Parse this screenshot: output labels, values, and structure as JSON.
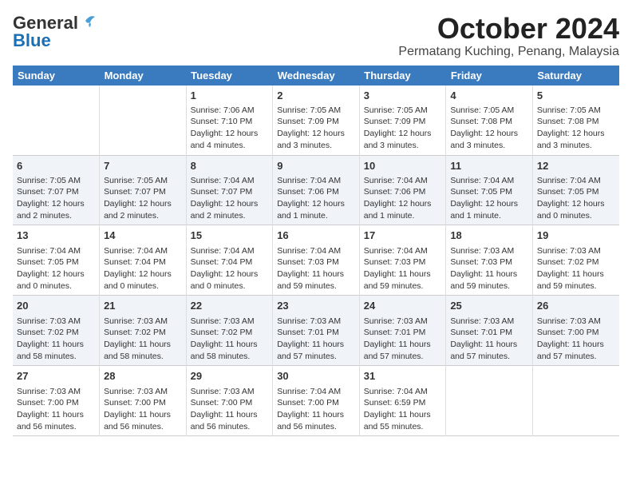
{
  "header": {
    "logo_general": "General",
    "logo_blue": "Blue",
    "month_title": "October 2024",
    "location": "Permatang Kuching, Penang, Malaysia"
  },
  "weekdays": [
    "Sunday",
    "Monday",
    "Tuesday",
    "Wednesday",
    "Thursday",
    "Friday",
    "Saturday"
  ],
  "weeks": [
    [
      {
        "day": "",
        "info": ""
      },
      {
        "day": "",
        "info": ""
      },
      {
        "day": "1",
        "info": "Sunrise: 7:06 AM\nSunset: 7:10 PM\nDaylight: 12 hours and 4 minutes."
      },
      {
        "day": "2",
        "info": "Sunrise: 7:05 AM\nSunset: 7:09 PM\nDaylight: 12 hours and 3 minutes."
      },
      {
        "day": "3",
        "info": "Sunrise: 7:05 AM\nSunset: 7:09 PM\nDaylight: 12 hours and 3 minutes."
      },
      {
        "day": "4",
        "info": "Sunrise: 7:05 AM\nSunset: 7:08 PM\nDaylight: 12 hours and 3 minutes."
      },
      {
        "day": "5",
        "info": "Sunrise: 7:05 AM\nSunset: 7:08 PM\nDaylight: 12 hours and 3 minutes."
      }
    ],
    [
      {
        "day": "6",
        "info": "Sunrise: 7:05 AM\nSunset: 7:07 PM\nDaylight: 12 hours and 2 minutes."
      },
      {
        "day": "7",
        "info": "Sunrise: 7:05 AM\nSunset: 7:07 PM\nDaylight: 12 hours and 2 minutes."
      },
      {
        "day": "8",
        "info": "Sunrise: 7:04 AM\nSunset: 7:07 PM\nDaylight: 12 hours and 2 minutes."
      },
      {
        "day": "9",
        "info": "Sunrise: 7:04 AM\nSunset: 7:06 PM\nDaylight: 12 hours and 1 minute."
      },
      {
        "day": "10",
        "info": "Sunrise: 7:04 AM\nSunset: 7:06 PM\nDaylight: 12 hours and 1 minute."
      },
      {
        "day": "11",
        "info": "Sunrise: 7:04 AM\nSunset: 7:05 PM\nDaylight: 12 hours and 1 minute."
      },
      {
        "day": "12",
        "info": "Sunrise: 7:04 AM\nSunset: 7:05 PM\nDaylight: 12 hours and 0 minutes."
      }
    ],
    [
      {
        "day": "13",
        "info": "Sunrise: 7:04 AM\nSunset: 7:05 PM\nDaylight: 12 hours and 0 minutes."
      },
      {
        "day": "14",
        "info": "Sunrise: 7:04 AM\nSunset: 7:04 PM\nDaylight: 12 hours and 0 minutes."
      },
      {
        "day": "15",
        "info": "Sunrise: 7:04 AM\nSunset: 7:04 PM\nDaylight: 12 hours and 0 minutes."
      },
      {
        "day": "16",
        "info": "Sunrise: 7:04 AM\nSunset: 7:03 PM\nDaylight: 11 hours and 59 minutes."
      },
      {
        "day": "17",
        "info": "Sunrise: 7:04 AM\nSunset: 7:03 PM\nDaylight: 11 hours and 59 minutes."
      },
      {
        "day": "18",
        "info": "Sunrise: 7:03 AM\nSunset: 7:03 PM\nDaylight: 11 hours and 59 minutes."
      },
      {
        "day": "19",
        "info": "Sunrise: 7:03 AM\nSunset: 7:02 PM\nDaylight: 11 hours and 59 minutes."
      }
    ],
    [
      {
        "day": "20",
        "info": "Sunrise: 7:03 AM\nSunset: 7:02 PM\nDaylight: 11 hours and 58 minutes."
      },
      {
        "day": "21",
        "info": "Sunrise: 7:03 AM\nSunset: 7:02 PM\nDaylight: 11 hours and 58 minutes."
      },
      {
        "day": "22",
        "info": "Sunrise: 7:03 AM\nSunset: 7:02 PM\nDaylight: 11 hours and 58 minutes."
      },
      {
        "day": "23",
        "info": "Sunrise: 7:03 AM\nSunset: 7:01 PM\nDaylight: 11 hours and 57 minutes."
      },
      {
        "day": "24",
        "info": "Sunrise: 7:03 AM\nSunset: 7:01 PM\nDaylight: 11 hours and 57 minutes."
      },
      {
        "day": "25",
        "info": "Sunrise: 7:03 AM\nSunset: 7:01 PM\nDaylight: 11 hours and 57 minutes."
      },
      {
        "day": "26",
        "info": "Sunrise: 7:03 AM\nSunset: 7:00 PM\nDaylight: 11 hours and 57 minutes."
      }
    ],
    [
      {
        "day": "27",
        "info": "Sunrise: 7:03 AM\nSunset: 7:00 PM\nDaylight: 11 hours and 56 minutes."
      },
      {
        "day": "28",
        "info": "Sunrise: 7:03 AM\nSunset: 7:00 PM\nDaylight: 11 hours and 56 minutes."
      },
      {
        "day": "29",
        "info": "Sunrise: 7:03 AM\nSunset: 7:00 PM\nDaylight: 11 hours and 56 minutes."
      },
      {
        "day": "30",
        "info": "Sunrise: 7:04 AM\nSunset: 7:00 PM\nDaylight: 11 hours and 56 minutes."
      },
      {
        "day": "31",
        "info": "Sunrise: 7:04 AM\nSunset: 6:59 PM\nDaylight: 11 hours and 55 minutes."
      },
      {
        "day": "",
        "info": ""
      },
      {
        "day": "",
        "info": ""
      }
    ]
  ]
}
